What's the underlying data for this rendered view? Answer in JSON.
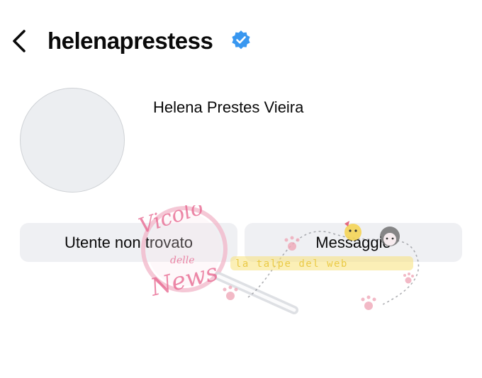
{
  "header": {
    "back_icon": "chevron-left-icon",
    "username": "helenaprestess",
    "verified_icon": "verified-badge-icon",
    "verified_color": "#3897f0"
  },
  "profile": {
    "full_name": "Helena Prestes Vieira"
  },
  "actions": {
    "left_label": "Utente non trovato",
    "right_label": "Messaggio"
  },
  "watermark": {
    "line1": "Vicolo",
    "line2": "delle",
    "line3": "News",
    "banner": "la talpe del web",
    "color_pink": "#e86a92",
    "color_yellow": "#f2d04a"
  }
}
